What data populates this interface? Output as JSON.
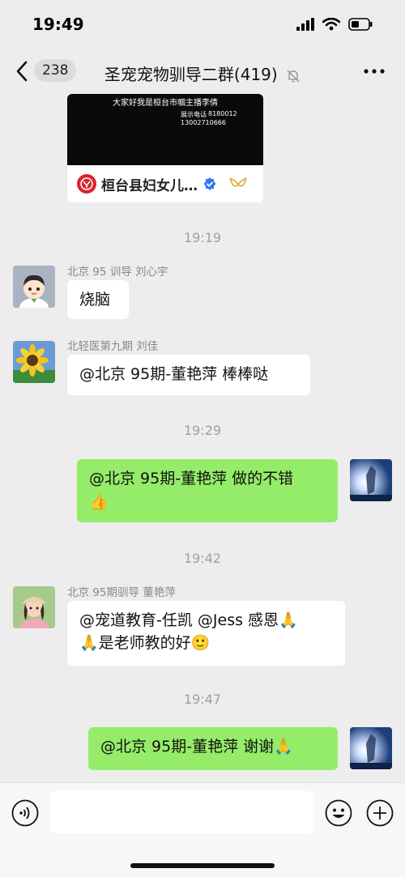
{
  "status_bar": {
    "time": "19:49",
    "icons": [
      "signal-icon",
      "wifi-icon",
      "battery-icon"
    ]
  },
  "nav": {
    "back_icon": "chevron-left-icon",
    "unread_count": "238",
    "title": "圣宠宠物驯导二群(419)",
    "mute_icon": "bell-off-icon",
    "more_icon": "more-icon"
  },
  "video_card": {
    "caption": "大家好我是桓台市帼主播李倩",
    "phone_label": "展示电话",
    "phone_1": "8180012",
    "phone_2": "13002710666",
    "channel_name": "桓台县妇女儿…",
    "icons": [
      "channel-logo-icon",
      "verified-icon",
      "channels-icon"
    ]
  },
  "timestamps": [
    "19:19",
    "19:29",
    "19:42",
    "19:47"
  ],
  "messages": [
    {
      "sender": "北京 95 训导 刘心宇",
      "text": "烧脑",
      "dir": "in"
    },
    {
      "sender": "北轻医第九期 刘佳",
      "text": "@北京 95期-董艳萍 棒棒哒",
      "dir": "in"
    },
    {
      "sender": "",
      "text": "@北京 95期-董艳萍 做的不错",
      "emoji": "👍",
      "dir": "out"
    },
    {
      "sender": "北京 95期驯导 董艳萍",
      "text": "@宠道教育-任凯 @Jess 感恩🙏",
      "text2": "🙏是老师教的好🙂",
      "dir": "in"
    },
    {
      "sender": "",
      "text": "@北京 95期-董艳萍 谢谢🙏",
      "dir": "out"
    }
  ],
  "input_bar": {
    "placeholder": "",
    "icons": [
      "voice-icon",
      "emoji-icon",
      "plus-icon"
    ]
  },
  "colors": {
    "background": "#ededed",
    "outgoing_bubble": "#95ec69",
    "incoming_bubble": "#ffffff"
  }
}
